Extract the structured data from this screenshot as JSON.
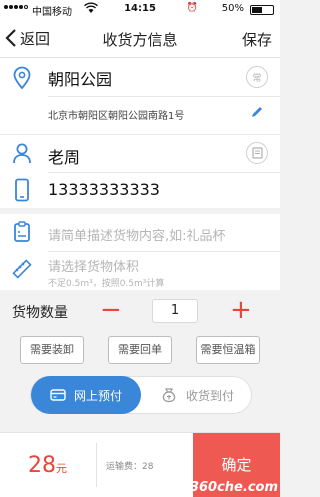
{
  "status_bar": {
    "carrier": "中国移动",
    "time": "14:15",
    "battery": "50%"
  },
  "nav": {
    "back_label": "返回",
    "title": "收货方信息",
    "save_label": "保存"
  },
  "address": {
    "name": "朝阳公园",
    "detail": "北京市朝阳区朝阳公园南路1号",
    "common_label": "常"
  },
  "contact": {
    "name": "老周",
    "phone": "13333333333"
  },
  "goods": {
    "placeholder": "请简单描述货物内容,如:礼品杯"
  },
  "volume": {
    "placeholder": "请选择货物体积",
    "hint": "不足0.5m³，按照0.5m³计算"
  },
  "quantity": {
    "label": "货物数量",
    "minus": "−",
    "value": "1",
    "plus": "+"
  },
  "options": [
    {
      "label": "需要装卸"
    },
    {
      "label": "需要回单"
    },
    {
      "label": "需要恒温箱"
    }
  ],
  "payment": {
    "online_label": "网上预付",
    "arrival_label": "收货到付"
  },
  "bottom": {
    "price": "28",
    "price_unit": "元",
    "fee_label": "运输费：28",
    "confirm_label": "确定"
  },
  "watermark": "www.360che.com",
  "colors": {
    "accent_red": "#e8453c",
    "accent_blue": "#3a86d9",
    "icon_blue": "#3a86d9"
  }
}
